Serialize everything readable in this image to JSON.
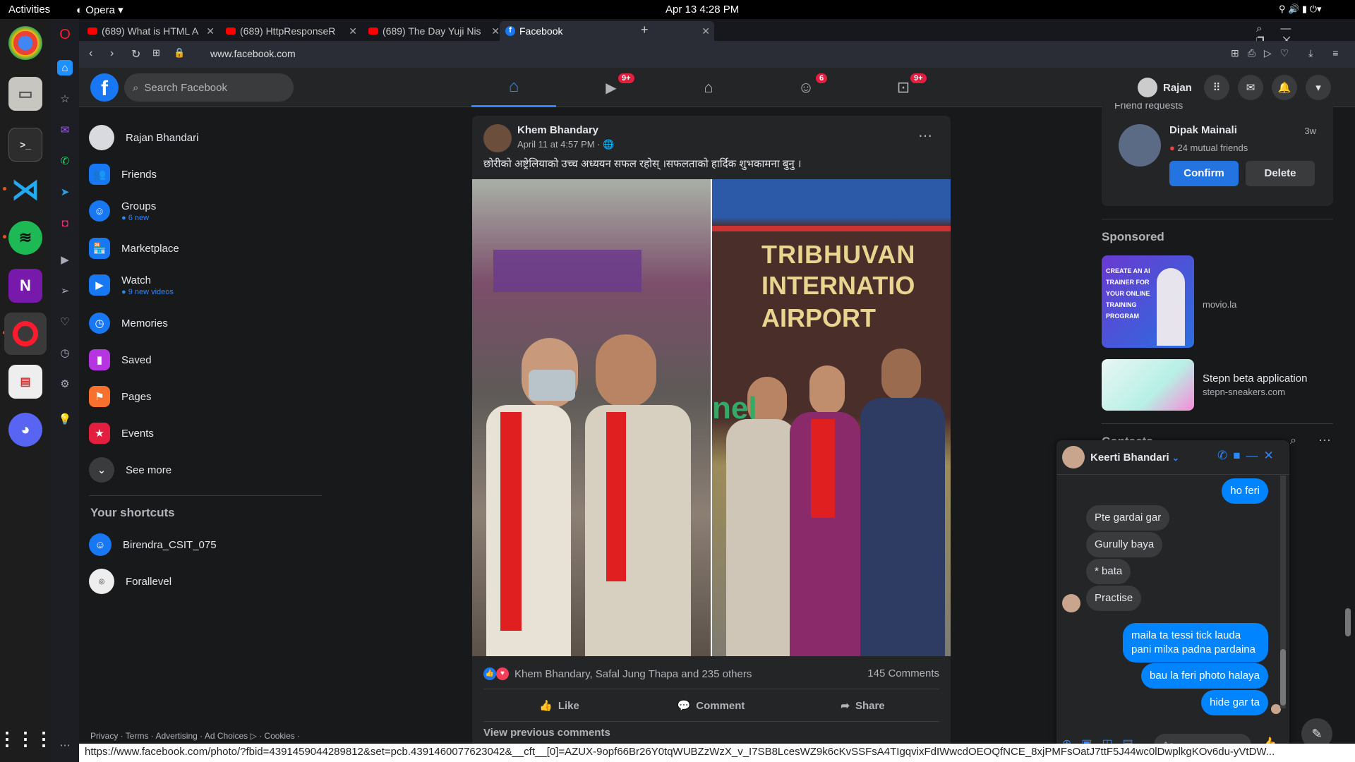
{
  "system": {
    "activities": "Activities",
    "app_menu": "Opera",
    "datetime": "Apr 13  4:28 PM"
  },
  "tabs": [
    {
      "label": "(689) What is HTML A"
    },
    {
      "label": "(689) HttpResponseR"
    },
    {
      "label": "(689) The Day Yuji Nis"
    },
    {
      "label": "Facebook"
    }
  ],
  "address": {
    "url": "www.facebook.com"
  },
  "header": {
    "search_placeholder": "Search Facebook",
    "watch_badge": "9+",
    "groups_badge": "6",
    "gaming_badge": "9+",
    "profile_name": "Rajan"
  },
  "left_nav": {
    "profile": "Rajan Bhandari",
    "items": [
      {
        "label": "Friends",
        "sub": ""
      },
      {
        "label": "Groups",
        "sub": "6 new"
      },
      {
        "label": "Marketplace",
        "sub": ""
      },
      {
        "label": "Watch",
        "sub": "9 new videos"
      },
      {
        "label": "Memories",
        "sub": ""
      },
      {
        "label": "Saved",
        "sub": ""
      },
      {
        "label": "Pages",
        "sub": ""
      },
      {
        "label": "Events",
        "sub": ""
      },
      {
        "label": "See more",
        "sub": ""
      }
    ],
    "shortcuts_title": "Your shortcuts",
    "shortcuts": [
      "Birendra_CSIT_075",
      "Forallevel"
    ],
    "footer": "Privacy · Terms · Advertising · Ad Choices ▷ · Cookies ·"
  },
  "post": {
    "author": "Khem Bhandary",
    "time": "April 11 at 4:57 PM ·",
    "text": "छोरीको अष्ट्रेलियाको उच्च अध्ययन सफल रहोस् ।सफलताको हार्दिक  शुभकामना  बुनु ।",
    "photo_text_line1": "TRIBHUVAN",
    "photo_text_line2": "INTERNATIO",
    "photo_text_line3": "AIRPORT",
    "reactions": "Khem Bhandary, Safal Jung Thapa and 235 others",
    "comments_count": "145 Comments",
    "like": "Like",
    "comment": "Comment",
    "share": "Share",
    "view_prev": "View previous comments"
  },
  "right": {
    "friend_requests_title": "Friend requests",
    "requester": "Dipak Mainali",
    "request_age": "3w",
    "mutual": "24 mutual friends",
    "confirm": "Confirm",
    "delete": "Delete",
    "sponsored": "Sponsored",
    "ads": [
      {
        "title": "",
        "domain": "movio.la",
        "thumb_text": "CREATE AN AI TRAINER FOR YOUR ONLINE TRAINING PROGRAM"
      },
      {
        "title": "Stepn beta application",
        "domain": "stepn-sneakers.com",
        "thumb_text": ""
      }
    ],
    "contacts": "Contacts"
  },
  "chat": {
    "name": "Keerti Bhandari",
    "messages": [
      {
        "dir": "out",
        "text": "ho feri"
      },
      {
        "dir": "in",
        "text": "Pte gardai gar"
      },
      {
        "dir": "in",
        "text": "Gurully baya"
      },
      {
        "dir": "in",
        "text": "* bata"
      },
      {
        "dir": "in",
        "text": "Practise"
      },
      {
        "dir": "out",
        "text": "maila ta tessi tick lauda pani milxa padna pardaina"
      },
      {
        "dir": "out",
        "text": "bau la feri photo halaya"
      },
      {
        "dir": "out",
        "text": "hide gar ta"
      }
    ],
    "input_placeholder": "Aa"
  },
  "status_url": "https://www.facebook.com/photo/?fbid=4391459044289812&set=pcb.4391460077623042&__cft__[0]=AZUX-9opf66Br26Y0tqWUBZzWzX_v_I7SB8LcesWZ9k6cKvSSFsA4TIgqvixFdIWwcdOEOQfNCE_8xjPMFsOatJ7ttF5J44wc0lDwplkgKOv6du-yVtDW..."
}
